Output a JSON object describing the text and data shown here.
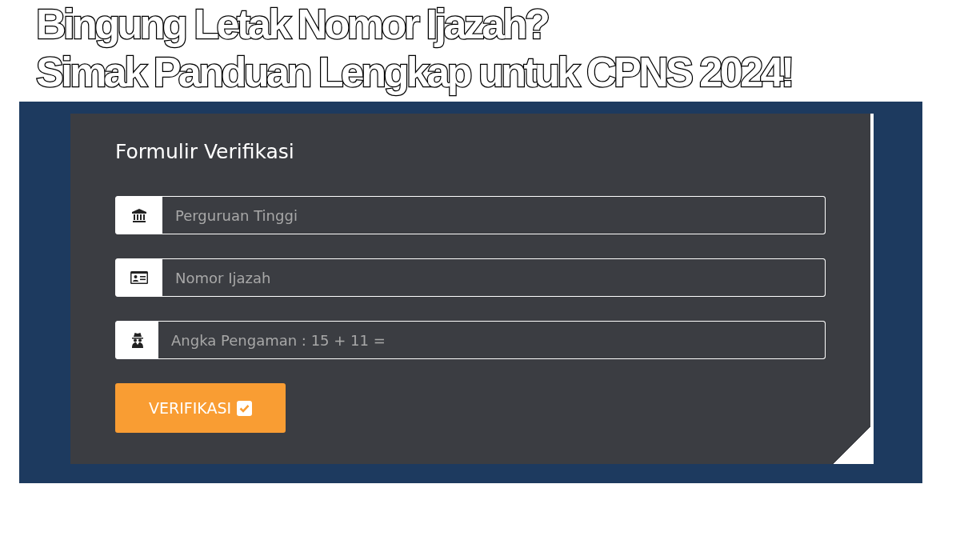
{
  "headline": [
    "Bingung Letak Nomor Ijazah?",
    "Simak Panduan Lengkap untuk CPNS 2024!"
  ],
  "form": {
    "title": "Formulir Verifikasi",
    "fields": [
      {
        "kind": "institution",
        "placeholder": "Perguruan Tinggi"
      },
      {
        "kind": "certificate",
        "placeholder": "Nomor Ijazah"
      },
      {
        "kind": "captcha",
        "placeholder": "Angka Pengaman : 15 + 11 ="
      }
    ],
    "button": "VERIFIKASI"
  }
}
